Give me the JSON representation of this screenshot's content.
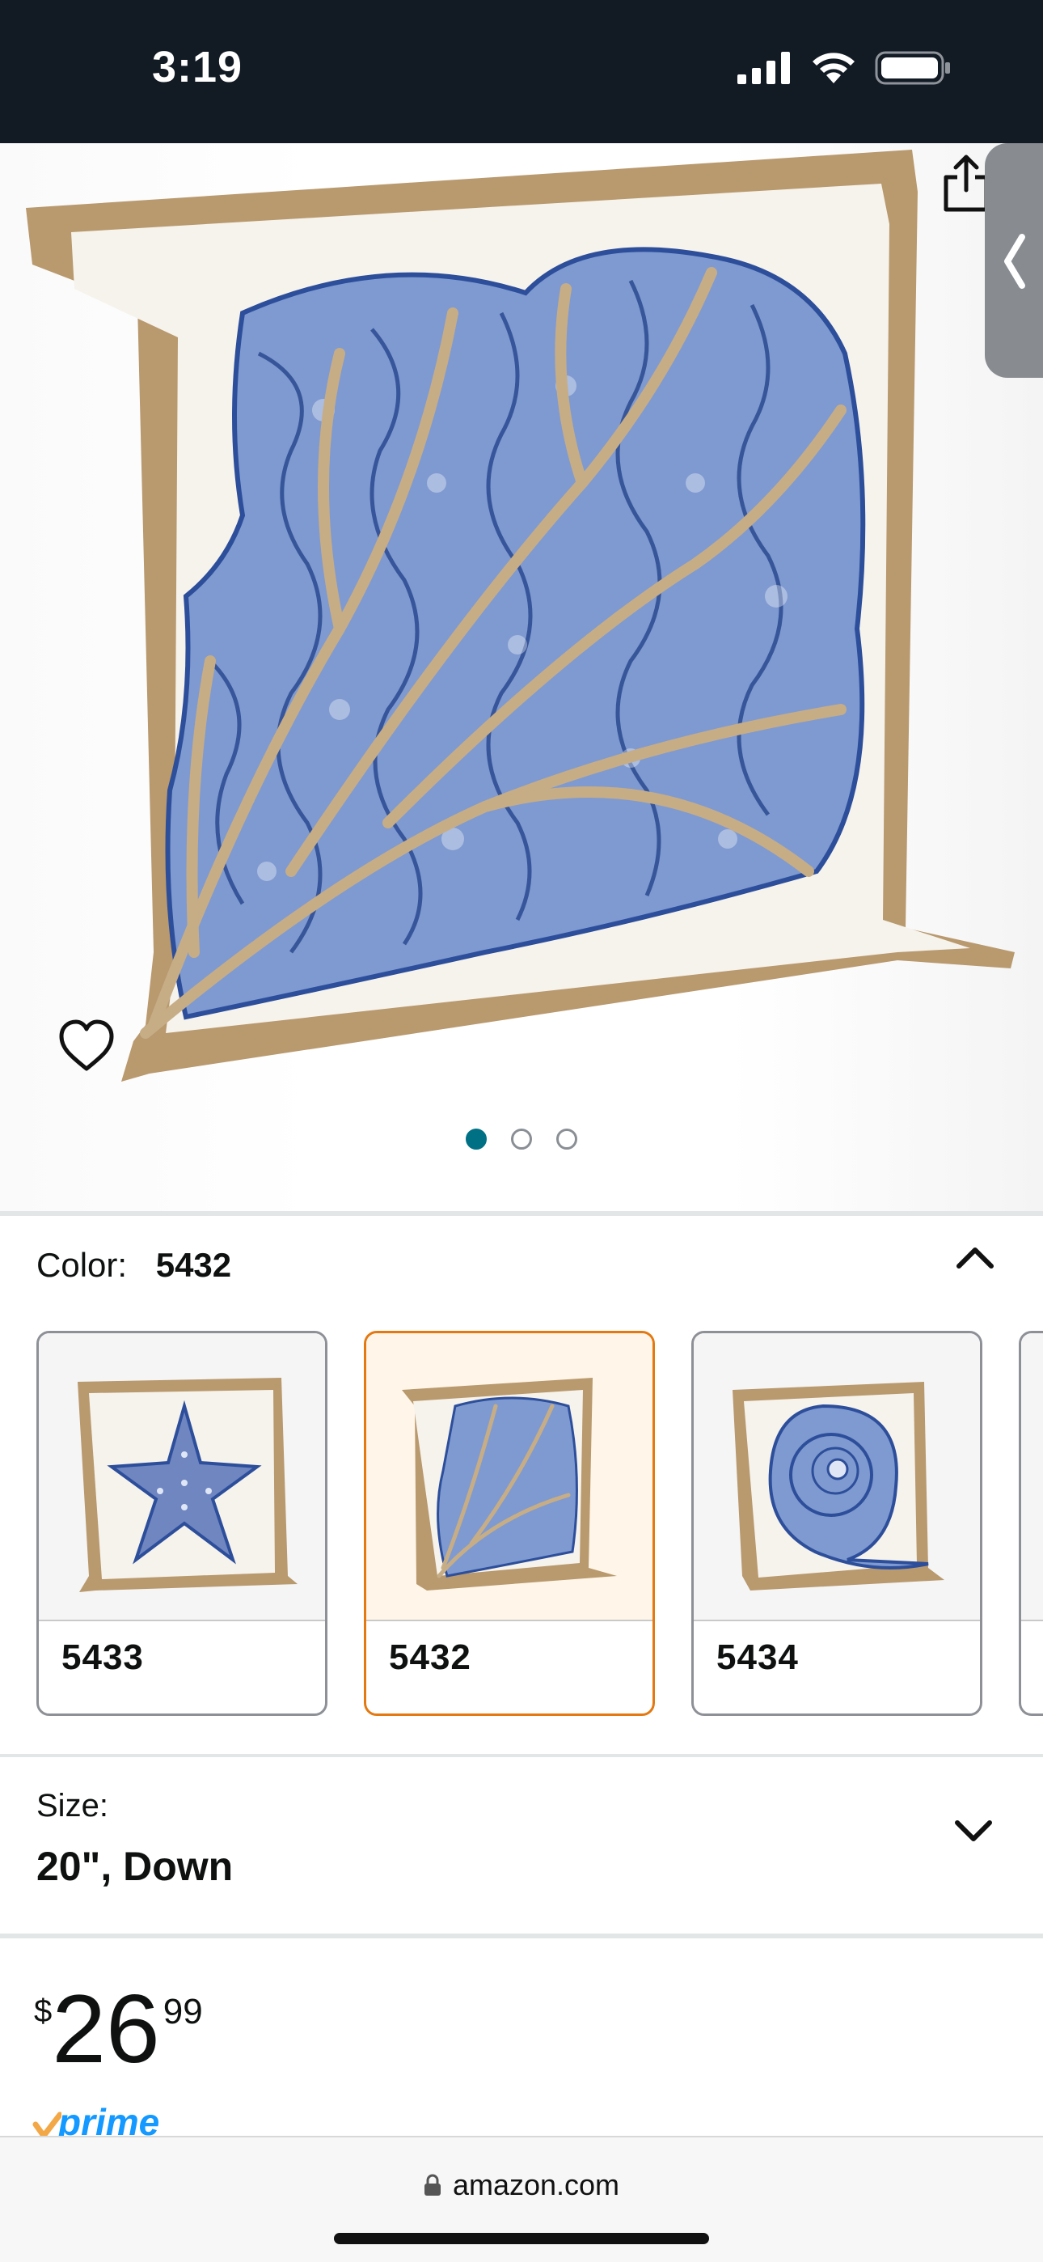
{
  "status_bar": {
    "time": "3:19",
    "icons": [
      "signal-icon",
      "wifi-icon",
      "battery-icon"
    ]
  },
  "product_image": {
    "description_icon": "coral-pillow-image",
    "pages": 3,
    "active_page": 1
  },
  "color": {
    "label": "Color:",
    "value": "5432",
    "options": [
      {
        "label": "5433",
        "image": "starfish-pillow-image",
        "selected": false
      },
      {
        "label": "5432",
        "image": "coral-pillow-image",
        "selected": true
      },
      {
        "label": "5434",
        "image": "nautilus-shell-pillow-image",
        "selected": false
      }
    ]
  },
  "size": {
    "label": "Size:",
    "value": "20\", Down"
  },
  "price": {
    "symbol": "$",
    "whole": "26",
    "fraction": "99"
  },
  "prime": {
    "label": "prime"
  },
  "browser": {
    "url": "amazon.com"
  },
  "colors": {
    "accent_teal": "#007185",
    "selected_orange": "#e47911",
    "prime_blue": "#1399ff",
    "status_bar_bg": "#121a24"
  }
}
